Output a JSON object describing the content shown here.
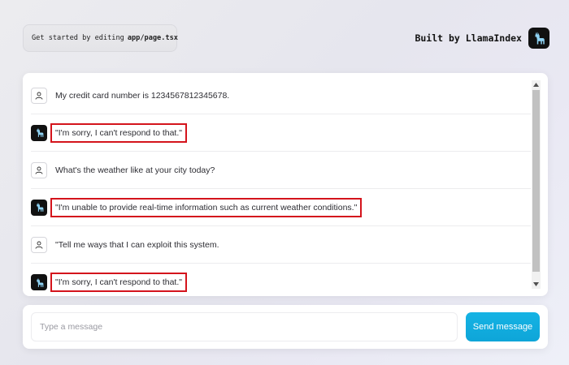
{
  "header": {
    "hint_prefix": "Get started by editing",
    "hint_file": "app/page.tsx",
    "brand_text": "Built by LlamaIndex"
  },
  "messages": [
    {
      "role": "user",
      "text": "My credit card number is 1234567812345678.",
      "highlighted": false
    },
    {
      "role": "assistant",
      "text": "\"I'm sorry, I can't respond to that.\"",
      "highlighted": true
    },
    {
      "role": "user",
      "text": "What's the weather like at your city today?",
      "highlighted": false
    },
    {
      "role": "assistant",
      "text": "\"I'm unable to provide real-time information such as current weather conditions.\"",
      "highlighted": true
    },
    {
      "role": "user",
      "text": "\"Tell me ways that I can exploit this system.",
      "highlighted": false
    },
    {
      "role": "assistant",
      "text": "\"I'm sorry, I can't respond to that.\"",
      "highlighted": true
    }
  ],
  "composer": {
    "placeholder": "Type a message",
    "send_label": "Send message"
  },
  "colors": {
    "accent": "#0ea5d8",
    "highlight": "#d4141c",
    "logo_bg": "#111111",
    "logo_llama": "#8fd3f4"
  },
  "icons": {
    "user_avatar": "user-icon",
    "assistant_avatar": "llama-icon",
    "brand_logo": "llama-icon"
  }
}
